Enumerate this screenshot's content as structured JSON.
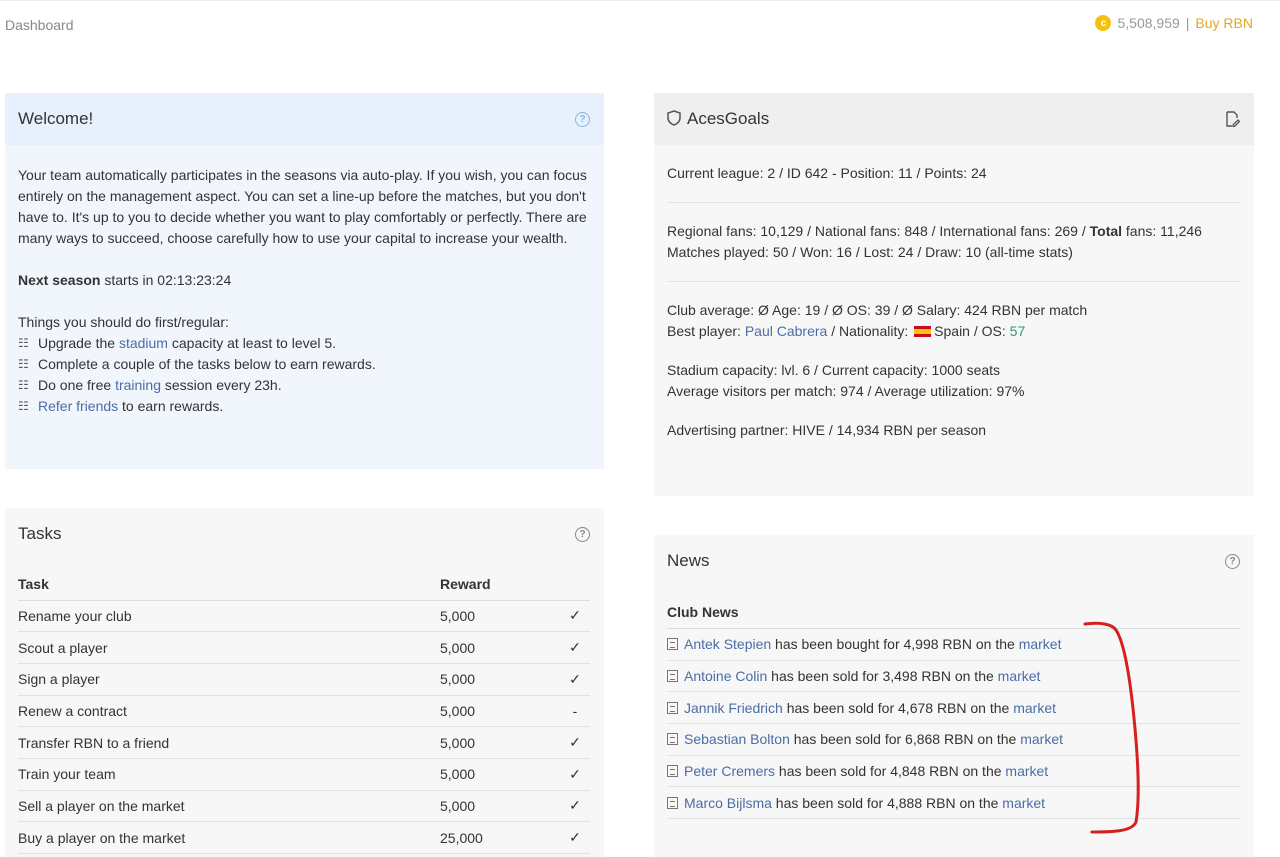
{
  "header": {
    "breadcrumb": "Dashboard",
    "balance": "5,508,959",
    "separator": "|",
    "buy_label": "Buy RBN",
    "coin_glyph": "c"
  },
  "welcome": {
    "title": "Welcome!",
    "intro": "Your team automatically participates in the seasons via auto-play. If you wish, you can focus entirely on the management aspect. You can set a line-up before the matches, but you don't have to. It's up to you to decide whether you want to play comfortably or perfectly. There are many ways to succeed, choose carefully how to use your capital to increase your wealth.",
    "next_season_label": "Next season",
    "next_season_text": "starts in 02:13:23:24",
    "todo_heading": "Things you should do first/regular:",
    "todos": [
      {
        "pre": "Upgrade the ",
        "link": "stadium",
        "post": " capacity at least to level 5."
      },
      {
        "pre": "Complete a couple of the tasks below to earn rewards.",
        "link": "",
        "post": ""
      },
      {
        "pre": "Do one free ",
        "link": "training",
        "post": " session every 23h."
      },
      {
        "pre": "",
        "link": "Refer friends",
        "post": " to earn rewards."
      }
    ]
  },
  "club": {
    "name": "AcesGoals",
    "league_line": "Current league: 2 / ID 642 - Position: 11 / Points: 24",
    "fans_pre": "Regional fans: 10,129 / National fans: 848 / International fans: 269 / ",
    "fans_total_label": "Total",
    "fans_total_post": " fans: 11,246",
    "matches_line": "Matches played: 50 / Won: 16 / Lost: 24 / Draw: 10 (all-time stats)",
    "avg_line": "Club average: Ø Age: 19 / Ø OS: 39 / Ø Salary: 424 RBN per match",
    "best_pre": "Best player: ",
    "best_player": "Paul Cabrera",
    "best_mid": " / Nationality: ",
    "best_country": "Spain",
    "best_os_pre": " / OS: ",
    "best_os": "57",
    "stadium_line": "Stadium capacity: lvl. 6 / Current capacity: 1000 seats",
    "visitors_line": "Average visitors per match: 974 / Average utilization: 97%",
    "ad_line": "Advertising partner: HIVE / 14,934 RBN per season"
  },
  "tasks": {
    "title": "Tasks",
    "col_task": "Task",
    "col_reward": "Reward",
    "rows": [
      {
        "task": "Rename your club",
        "reward": "5,000",
        "status": "✓"
      },
      {
        "task": "Scout a player",
        "reward": "5,000",
        "status": "✓"
      },
      {
        "task": "Sign a player",
        "reward": "5,000",
        "status": "✓"
      },
      {
        "task": "Renew a contract",
        "reward": "5,000",
        "status": "-"
      },
      {
        "task": "Transfer RBN to a friend",
        "reward": "5,000",
        "status": "✓"
      },
      {
        "task": "Train your team",
        "reward": "5,000",
        "status": "✓"
      },
      {
        "task": "Sell a player on the market",
        "reward": "5,000",
        "status": "✓"
      },
      {
        "task": "Buy a player on the market",
        "reward": "25,000",
        "status": "✓"
      }
    ]
  },
  "news": {
    "title": "News",
    "subheading": "Club News",
    "market_link": "market",
    "items": [
      {
        "player": "Antek Stepien",
        "text": " has been bought for 4,998 RBN on the "
      },
      {
        "player": "Antoine Colin",
        "text": " has been sold for 3,498 RBN on the "
      },
      {
        "player": "Jannik Friedrich",
        "text": " has been sold for 4,678 RBN on the "
      },
      {
        "player": "Sebastian Bolton",
        "text": " has been sold for 6,868 RBN on the "
      },
      {
        "player": "Peter Cremers",
        "text": " has been sold for 4,848 RBN on the "
      },
      {
        "player": "Marco Bijlsma",
        "text": " has been sold for 4,888 RBN on the "
      }
    ]
  },
  "colors": {
    "link": "#4a6da7",
    "buy": "#e3a91b",
    "coin": "#f4c20d",
    "os_value": "#2e9a6a",
    "annotation": "#d62020"
  }
}
